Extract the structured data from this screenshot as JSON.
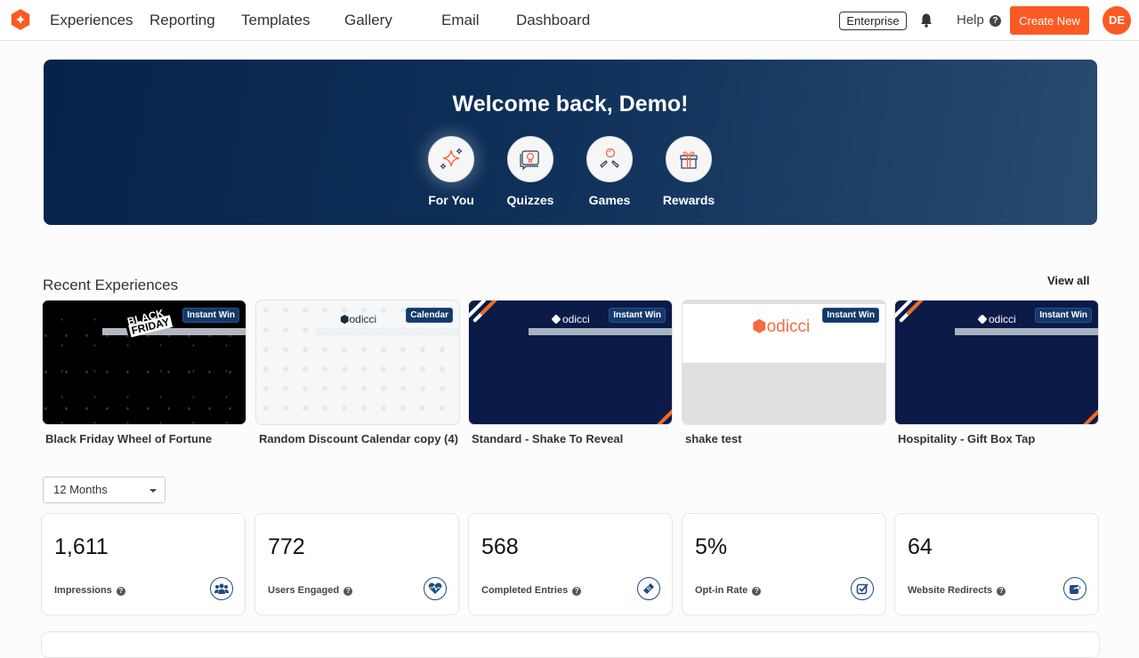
{
  "nav": {
    "items": [
      "Experiences",
      "Reporting",
      "Templates",
      "Gallery",
      "Email",
      "Dashboard"
    ],
    "plan_badge": "Enterprise",
    "help_label": "Help",
    "help_icon": "?",
    "create_label": "Create New",
    "avatar_initials": "DE",
    "brand_color": "#fb5a24"
  },
  "hero": {
    "title": "Welcome back, Demo!",
    "categories": [
      {
        "label": "For You",
        "icon": "sparkles-icon"
      },
      {
        "label": "Quizzes",
        "icon": "lightbulb-chat-icon"
      },
      {
        "label": "Games",
        "icon": "pinball-icon"
      },
      {
        "label": "Rewards",
        "icon": "gift-icon"
      }
    ]
  },
  "recent": {
    "title": "Recent Experiences",
    "view_all": "View all",
    "items": [
      {
        "name": "Black Friday Wheel of Fortune",
        "badge": "Instant Win",
        "thumb_text": "BLACK FRIDAY"
      },
      {
        "name": "Random Discount Calendar copy (4)",
        "badge": "Calendar",
        "thumb_text": "odicci"
      },
      {
        "name": "Standard - Shake To Reveal",
        "badge": "Instant Win",
        "thumb_text": "odicci"
      },
      {
        "name": "shake test",
        "badge": "Instant Win",
        "thumb_text": "odicci"
      },
      {
        "name": "Hospitality - Gift Box Tap",
        "badge": "Instant Win",
        "thumb_text": "odicci"
      }
    ]
  },
  "filter": {
    "period": "12 Months"
  },
  "stats": [
    {
      "value": "1,611",
      "label": "Impressions",
      "icon": "users-group-icon"
    },
    {
      "value": "772",
      "label": "Users Engaged",
      "icon": "heart-pulse-icon"
    },
    {
      "value": "568",
      "label": "Completed Entries",
      "icon": "ticket-icon"
    },
    {
      "value": "5%",
      "label": "Opt-in Rate",
      "icon": "checkbox-icon"
    },
    {
      "value": "64",
      "label": "Website Redirects",
      "icon": "share-icon"
    }
  ],
  "help_glyph": "?"
}
